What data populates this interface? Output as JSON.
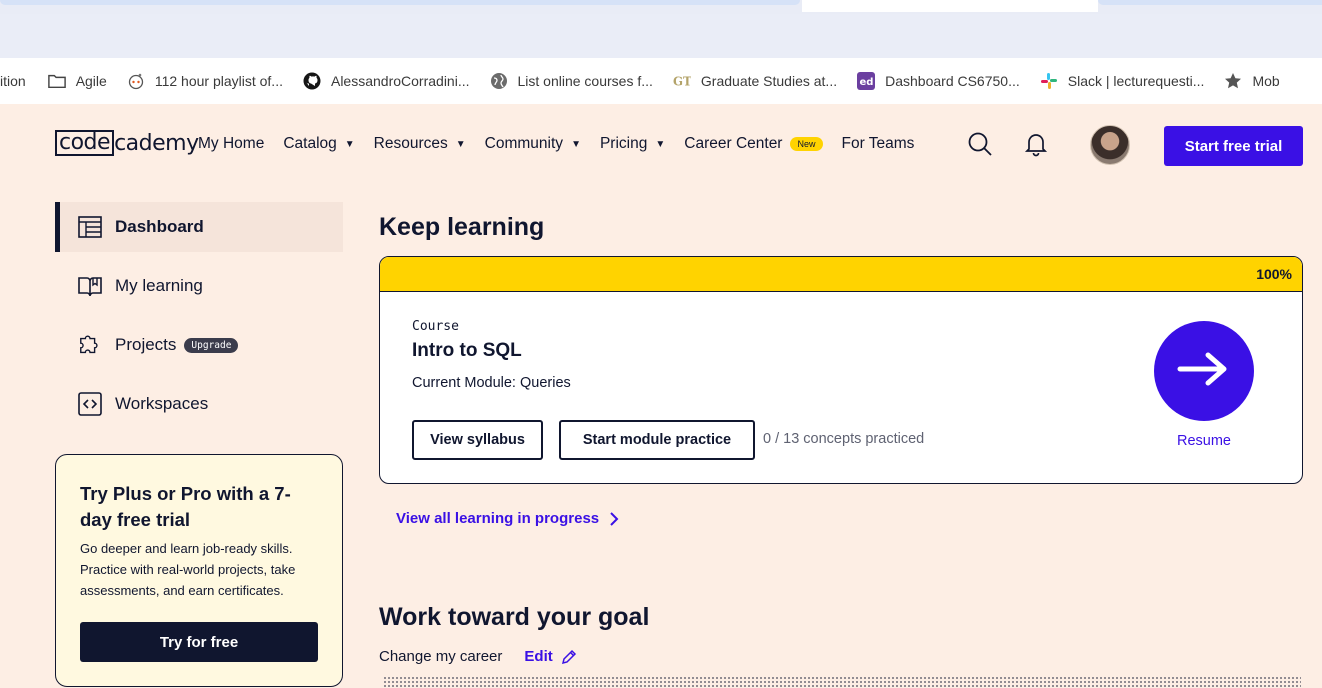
{
  "bookmarks": [
    {
      "label": "ition",
      "icon": "none"
    },
    {
      "label": "Agile",
      "icon": "folder-icon"
    },
    {
      "label": "112 hour playlist of...",
      "icon": "reddit-icon"
    },
    {
      "label": "AlessandroCorradini...",
      "icon": "github-icon"
    },
    {
      "label": "List online courses f...",
      "icon": "globe-icon"
    },
    {
      "label": "Graduate Studies at...",
      "icon": "gt-icon"
    },
    {
      "label": "Dashboard CS6750...",
      "icon": "ed-icon"
    },
    {
      "label": "Slack | lecturequesti...",
      "icon": "slack-icon"
    },
    {
      "label": "Mob",
      "icon": "star-icon"
    }
  ],
  "header": {
    "logo_code": "code",
    "logo_rest": "cademy",
    "nav": {
      "home": "My Home",
      "catalog": "Catalog",
      "resources": "Resources",
      "community": "Community",
      "pricing": "Pricing",
      "career": "Career Center",
      "new_badge": "New",
      "teams": "For Teams"
    },
    "cta": "Start free trial"
  },
  "sidebar": {
    "items": [
      {
        "label": "Dashboard",
        "icon": "dashboard-icon"
      },
      {
        "label": "My learning",
        "icon": "book-icon"
      },
      {
        "label": "Projects",
        "icon": "puzzle-icon"
      },
      {
        "label": "Workspaces",
        "icon": "code-brackets-icon"
      }
    ],
    "upgrade_badge": "Upgrade",
    "promo": {
      "title": "Try Plus or Pro with a 7-day free trial",
      "body": "Go deeper and learn job-ready skills. Practice with real-world projects, take assessments, and earn certificates.",
      "button": "Try for free"
    }
  },
  "main": {
    "keep_learning_title": "Keep learning",
    "card": {
      "progress": 1.0,
      "progress_label": "100%",
      "course_label": "Course",
      "course_title": "Intro to SQL",
      "module": "Current Module: Queries",
      "view_syllabus": "View syllabus",
      "start_practice": "Start module practice",
      "concepts": "0 / 13 concepts practiced",
      "resume": "Resume"
    },
    "view_all": "View all learning in progress",
    "goal_title": "Work toward your goal",
    "goal_text": "Change my career",
    "edit": "Edit"
  },
  "colors": {
    "accent": "#3a10e5",
    "progress": "#ffd300",
    "navy": "#10162f",
    "page_bg": "#fdeee4"
  }
}
